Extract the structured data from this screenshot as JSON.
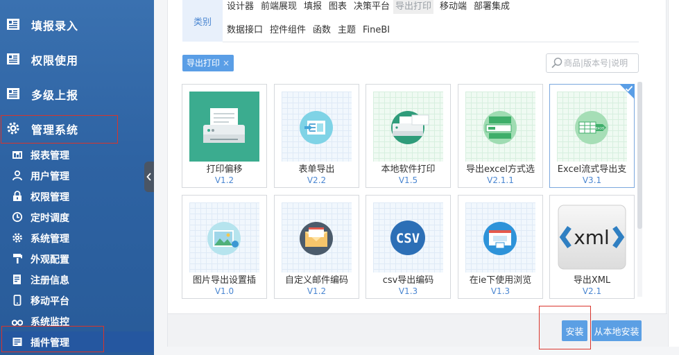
{
  "sidebar": {
    "main_items": [
      {
        "label": "填报录入",
        "icon": "form-icon"
      },
      {
        "label": "权限使用",
        "icon": "form-icon"
      },
      {
        "label": "多级上报",
        "icon": "form-icon"
      },
      {
        "label": "管理系统",
        "icon": "gear-icon"
      }
    ],
    "sub_items": [
      {
        "label": "报表管理",
        "icon": "report-icon"
      },
      {
        "label": "用户管理",
        "icon": "user-icon"
      },
      {
        "label": "权限管理",
        "icon": "lock-icon"
      },
      {
        "label": "定时调度",
        "icon": "clock-icon"
      },
      {
        "label": "系统管理",
        "icon": "gear-icon"
      },
      {
        "label": "外观配置",
        "icon": "brush-icon"
      },
      {
        "label": "注册信息",
        "icon": "register-icon"
      },
      {
        "label": "移动平台",
        "icon": "phone-icon"
      },
      {
        "label": "系统监控",
        "icon": "binoculars-icon"
      },
      {
        "label": "插件管理",
        "icon": "plugin-icon"
      }
    ]
  },
  "filters": {
    "category_label": "类别",
    "row1": [
      "设计器",
      "前端展现",
      "填报",
      "图表",
      "决策平台",
      "导出打印",
      "移动端",
      "部署集成"
    ],
    "row2": [
      "数据接口",
      "控件组件",
      "函数",
      "主题",
      "FineBI"
    ],
    "selected": "导出打印",
    "active_tag": "导出打印",
    "tag_close": "×"
  },
  "search": {
    "placeholder": "商品|版本号|说明"
  },
  "plugins": [
    {
      "name": "打印偏移",
      "version": "V1.2"
    },
    {
      "name": "表单导出",
      "version": "V2.2"
    },
    {
      "name": "本地软件打印",
      "version": "V1.5"
    },
    {
      "name": "导出excel方式选",
      "version": "V2.1.1"
    },
    {
      "name": "Excel流式导出支",
      "version": "V3.1"
    },
    {
      "name": "图片导出设置插",
      "version": "V1.0"
    },
    {
      "name": "自定义邮件编码",
      "version": "V1.2"
    },
    {
      "name": "csv导出编码",
      "version": "V1.3"
    },
    {
      "name": "在ie下使用浏览",
      "version": "V1.3"
    },
    {
      "name": "导出XML",
      "version": "V2.1"
    }
  ],
  "thumb_text": {
    "excel_badge": "excel",
    "csv_badge": "CSV",
    "xml_badge": "xml"
  },
  "buttons": {
    "install": "安装",
    "install_local": "从本地安装"
  },
  "colors": {
    "sidebar": "#2e63a3",
    "accent": "#5b9fe4",
    "highlight": "#d9342b"
  }
}
